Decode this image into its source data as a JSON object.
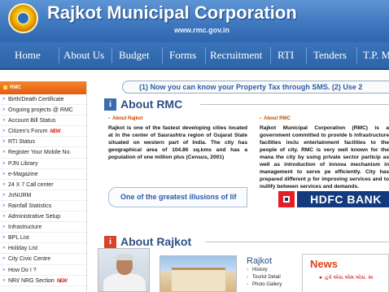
{
  "header": {
    "title": "Rajkot Municipal Corporation",
    "url": "www.rmc.gov.in"
  },
  "nav": {
    "items": [
      "Home",
      "About Us",
      "Budget",
      "Forms",
      "Recruitment",
      "RTI",
      "Tenders",
      "T.P. M"
    ]
  },
  "sidebar": {
    "heading": "RMC",
    "items": [
      {
        "label": "Birth/Death Certificate",
        "new": false
      },
      {
        "label": "Ongoing projects @ RMC",
        "new": false
      },
      {
        "label": "Account Bill Status",
        "new": false
      },
      {
        "label": "Citizen's Forum",
        "new": true
      },
      {
        "label": "RTI Status",
        "new": false
      },
      {
        "label": "Register Your Mobile No.",
        "new": false
      },
      {
        "label": "PJN Library",
        "new": false
      },
      {
        "label": "e-Magazine",
        "new": false
      },
      {
        "label": "24 X 7 Call center",
        "new": false
      },
      {
        "label": "JnNURM",
        "new": false
      },
      {
        "label": "Rainfall Statistics",
        "new": false
      },
      {
        "label": "Administrative Setup",
        "new": false
      },
      {
        "label": "Infrastructure",
        "new": false
      },
      {
        "label": "BPL List",
        "new": false
      },
      {
        "label": "Holiday List",
        "new": false
      },
      {
        "label": "City Civic Centre",
        "new": false
      },
      {
        "label": "How Do I ?",
        "new": false
      },
      {
        "label": "NRI/ NRG Section",
        "new": true
      }
    ],
    "new_badge": "NEW"
  },
  "marquee": "(1) Now you can know your Property Tax through SMS.    (2) Use 2",
  "about_rmc": {
    "title": "About RMC",
    "left_heading": "About Rajkot",
    "left_text": "Rajkot is one of the fastest developing cities located at in the center of Saurashtra region of Gujarat State situated on western part of India. The city has geographical area of 104.86 sq.kms and has a population of one million plus (Census, 2001)",
    "right_heading": "About RMC",
    "right_text": "Rajkot Municipal Corporation (RMC) is a government committed to provide b infrastructure facilities inclu entertainment facilities to the people of city. RMC is very well known for the mana the city by using private sector particip as well as introduction of innova mechanism in management to serve pe efficiently. City has prepared different p for improving services and to nullify between services and demands.",
    "illusion": "One of the greatest illusions of lif"
  },
  "ad": {
    "bank": "HDFC BANK"
  },
  "about_rajkot": {
    "title": "About Rajkot",
    "links_title": "Rajkot",
    "links": [
      "History",
      "Tourist Detail",
      "Photo Gallery"
    ]
  },
  "news": {
    "title": "News",
    "item": "હવે એસ.એમ.એસ. મા"
  },
  "colors": {
    "header_blue": "#3f78bf",
    "sidebar_orange": "#e35d12",
    "accent_blue": "#2d4f86",
    "hdfc_red": "#e31e24",
    "hdfc_blue": "#123a7c"
  }
}
